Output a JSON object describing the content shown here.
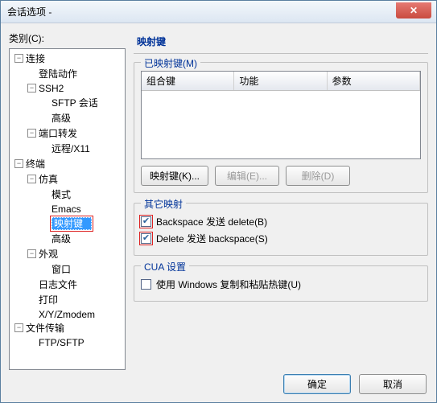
{
  "window": {
    "title": "会话选项 -"
  },
  "left": {
    "category_label": "类别(C):",
    "tree": [
      {
        "label": "连接",
        "depth": 0,
        "toggle": "-"
      },
      {
        "label": "登陆动作",
        "depth": 1
      },
      {
        "label": "SSH2",
        "depth": 1,
        "toggle": "-"
      },
      {
        "label": "SFTP 会话",
        "depth": 2
      },
      {
        "label": "高级",
        "depth": 2
      },
      {
        "label": "端口转发",
        "depth": 1,
        "toggle": "-"
      },
      {
        "label": "远程/X11",
        "depth": 2
      },
      {
        "label": "终端",
        "depth": 0,
        "toggle": "-"
      },
      {
        "label": "仿真",
        "depth": 1,
        "toggle": "-"
      },
      {
        "label": "模式",
        "depth": 2
      },
      {
        "label": "Emacs",
        "depth": 2
      },
      {
        "label": "映射键",
        "depth": 2,
        "selected": true
      },
      {
        "label": "高级",
        "depth": 2
      },
      {
        "label": "外观",
        "depth": 1,
        "toggle": "-"
      },
      {
        "label": "窗口",
        "depth": 2
      },
      {
        "label": "日志文件",
        "depth": 1
      },
      {
        "label": "打印",
        "depth": 1
      },
      {
        "label": "X/Y/Zmodem",
        "depth": 1
      },
      {
        "label": "文件传输",
        "depth": 0,
        "toggle": "-"
      },
      {
        "label": "FTP/SFTP",
        "depth": 1
      }
    ]
  },
  "right": {
    "title": "映射键",
    "mapped": {
      "group_title": "已映射键(M)",
      "columns": {
        "col1": "组合键",
        "col2": "功能",
        "col3": "参数"
      },
      "buttons": {
        "map": "映射键(K)...",
        "edit": "编辑(E)...",
        "delete": "删除(D)"
      }
    },
    "other": {
      "group_title": "其它映射",
      "opt1": "Backspace 发送 delete(B)",
      "opt2": "Delete 发送 backspace(S)"
    },
    "cua": {
      "group_title": "CUA 设置",
      "opt1": "使用 Windows 复制和粘贴热键(U)"
    }
  },
  "footer": {
    "ok": "确定",
    "cancel": "取消"
  }
}
